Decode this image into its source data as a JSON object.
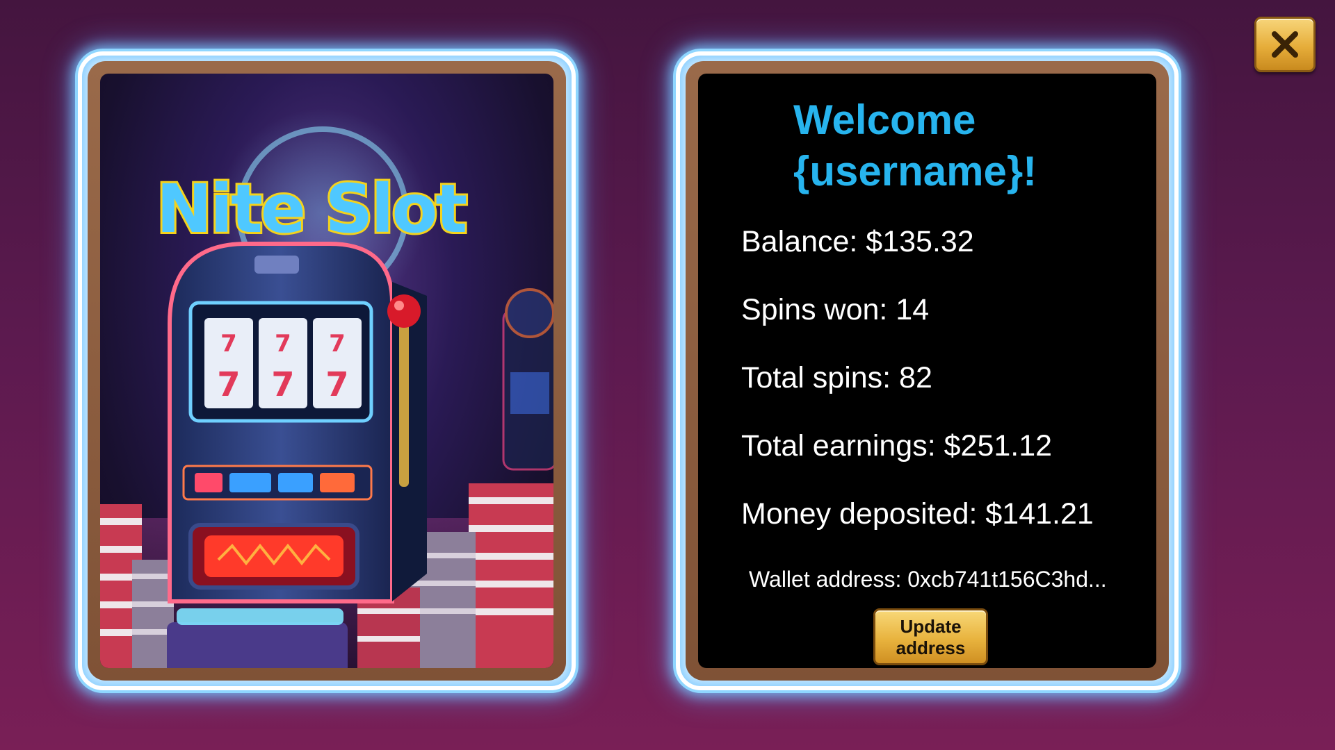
{
  "header": {
    "close_icon": "close-icon"
  },
  "artwork": {
    "logo_text": "Nite Slot",
    "reel_symbol": "7",
    "colors": {
      "logo_fill": "#4fc8ff",
      "logo_outline": "#f4d21c",
      "neon_glow": "#8fd6ff",
      "chip_red": "#c83a52",
      "chip_white": "#efe6ea"
    }
  },
  "profile": {
    "welcome_text": "Welcome {username}!",
    "balance": "Balance: $135.32",
    "spins_won": "Spins won: 14",
    "total_spins": "Total spins: 82",
    "total_earnings": "Total earnings: $251.12",
    "money_deposited": "Money deposited: $141.21",
    "wallet_address": "Wallet address: 0xcb741t156C3hd...",
    "update_address_label": "Update address"
  },
  "colors": {
    "welcome": "#27b4ee",
    "button_gold": "#e8b33e",
    "frame_wood": "#8a5a3d"
  }
}
